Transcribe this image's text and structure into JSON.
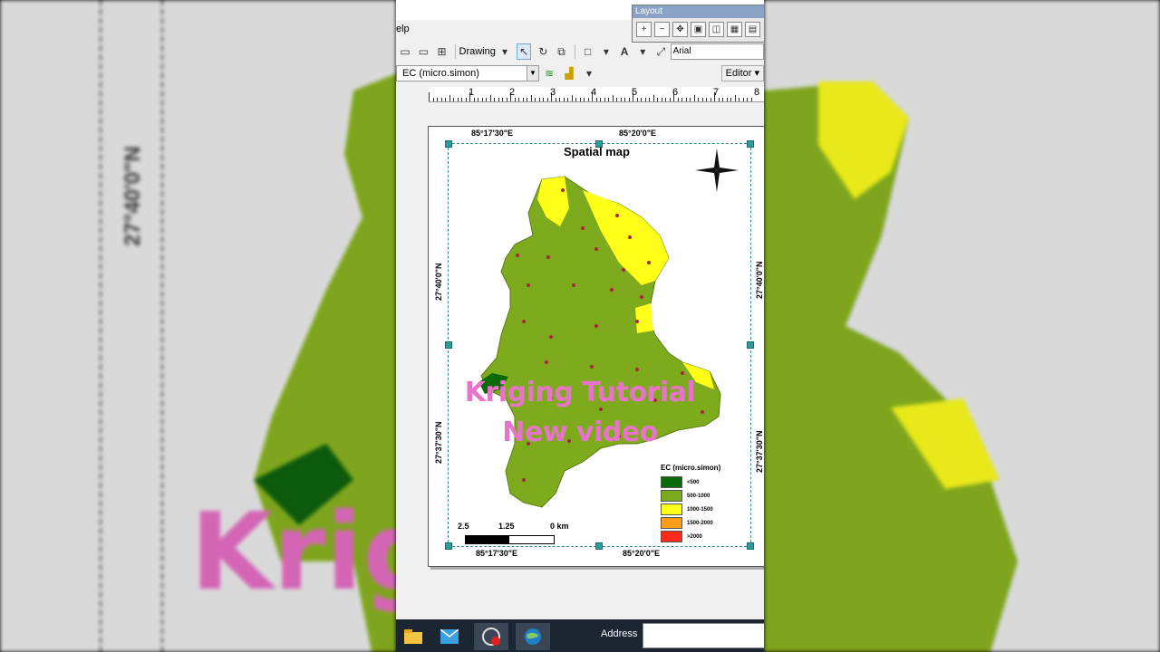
{
  "menu": {
    "help_fragment": "elp"
  },
  "layout_toolbar": {
    "title": "Layout"
  },
  "drawing_toolbar": {
    "drawing_label": "Drawing",
    "font_name": "Arial"
  },
  "layer_toolbar": {
    "layer_name": "EC (micro.simon)",
    "editor_label": "Editor"
  },
  "ruler": {
    "labels": [
      "1",
      "2",
      "3",
      "4",
      "5",
      "6",
      "7",
      "8"
    ]
  },
  "map": {
    "title": "Spatial map",
    "lon_top_left": "85°17'30\"E",
    "lon_top_right": "85°20'0\"E",
    "lon_bottom_left": "85°17'30\"E",
    "lon_bottom_right": "85°20'0\"E",
    "lat_upper": "27°40'0\"N",
    "lat_lower": "27°37'30\"N",
    "scale_labels": [
      "2.5",
      "1.25",
      "0 km"
    ],
    "legend": {
      "title": "EC (micro.simon)",
      "items": [
        {
          "label": "<500",
          "color": "#0a6a0a"
        },
        {
          "label": "500-1000",
          "color": "#7aaa1e"
        },
        {
          "label": "1000-1500",
          "color": "#ffff1a"
        },
        {
          "label": "1500-2000",
          "color": "#ff9d1a"
        },
        {
          "label": ">2000",
          "color": "#ff2a1a"
        }
      ]
    }
  },
  "overlay": {
    "line1": "Kriging Tutorial",
    "line2": "New video"
  },
  "background": {
    "big_text": "Krig ng Tutorial"
  },
  "taskbar": {
    "icons": [
      "file-explorer-icon",
      "mail-icon",
      "recorder-icon",
      "arcgis-icon"
    ],
    "address_label": "Address"
  }
}
